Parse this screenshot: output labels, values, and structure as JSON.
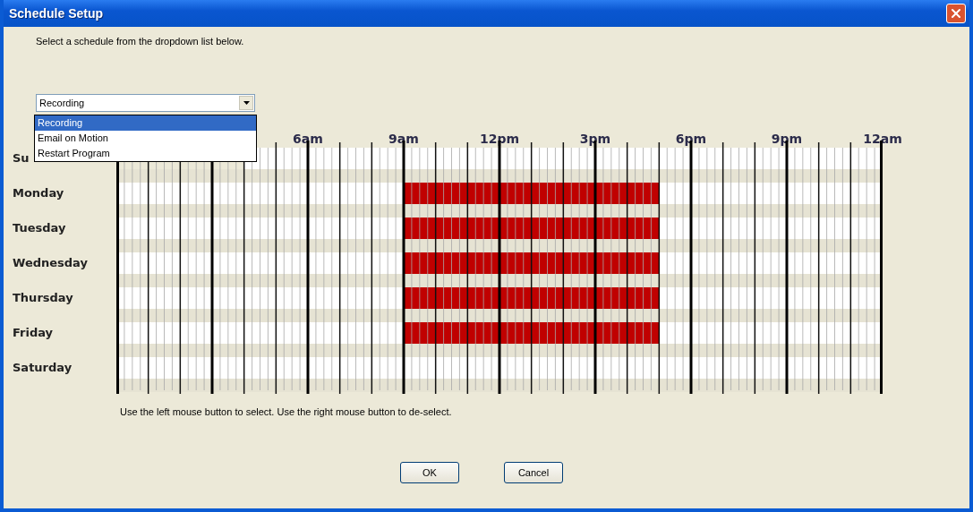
{
  "window": {
    "title": "Schedule Setup"
  },
  "instruction": "Select a schedule from the dropdown list below.",
  "schedule_select": {
    "value": "Recording",
    "options": [
      {
        "label": "Recording",
        "selected": true
      },
      {
        "label": "Email on Motion",
        "selected": false
      },
      {
        "label": "Restart Program",
        "selected": false
      }
    ]
  },
  "time_labels": [
    "6am",
    "9am",
    "12pm",
    "3pm",
    "6pm",
    "9pm",
    "12am"
  ],
  "days": [
    {
      "name": "Su",
      "hours": [
        {
          "selected": false
        },
        {
          "selected": false
        },
        {
          "selected": false
        },
        {
          "selected": false
        },
        {
          "selected": false
        },
        {
          "selected": false
        },
        {
          "selected": false
        },
        {
          "selected": false
        },
        {
          "selected": false
        },
        {
          "selected": false
        },
        {
          "selected": false
        },
        {
          "selected": false
        },
        {
          "selected": false
        },
        {
          "selected": false
        },
        {
          "selected": false
        },
        {
          "selected": false
        },
        {
          "selected": false
        },
        {
          "selected": false
        },
        {
          "selected": false
        },
        {
          "selected": false
        }
      ]
    },
    {
      "name": "Monday",
      "hours": [
        {
          "selected": false
        },
        {
          "selected": false
        },
        {
          "selected": false
        },
        {
          "selected": false
        },
        {
          "selected": false
        },
        {
          "selected": false
        },
        {
          "selected": false
        },
        {
          "selected": false
        },
        {
          "selected": false
        },
        {
          "selected": true
        },
        {
          "selected": true
        },
        {
          "selected": true
        },
        {
          "selected": true
        },
        {
          "selected": true
        },
        {
          "selected": true
        },
        {
          "selected": true
        },
        {
          "selected": true
        },
        {
          "selected": false
        },
        {
          "selected": false
        },
        {
          "selected": false
        },
        {
          "selected": false
        },
        {
          "selected": false
        },
        {
          "selected": false
        },
        {
          "selected": false
        }
      ]
    },
    {
      "name": "Tuesday",
      "hours": [
        {
          "selected": false
        },
        {
          "selected": false
        },
        {
          "selected": false
        },
        {
          "selected": false
        },
        {
          "selected": false
        },
        {
          "selected": false
        },
        {
          "selected": false
        },
        {
          "selected": false
        },
        {
          "selected": false
        },
        {
          "selected": true
        },
        {
          "selected": true
        },
        {
          "selected": true
        },
        {
          "selected": true
        },
        {
          "selected": true
        },
        {
          "selected": true
        },
        {
          "selected": true
        },
        {
          "selected": true
        },
        {
          "selected": false
        },
        {
          "selected": false
        },
        {
          "selected": false
        },
        {
          "selected": false
        },
        {
          "selected": false
        },
        {
          "selected": false
        },
        {
          "selected": false
        }
      ]
    },
    {
      "name": "Wednesday",
      "hours": [
        {
          "selected": false
        },
        {
          "selected": false
        },
        {
          "selected": false
        },
        {
          "selected": false
        },
        {
          "selected": false
        },
        {
          "selected": false
        },
        {
          "selected": false
        },
        {
          "selected": false
        },
        {
          "selected": false
        },
        {
          "selected": true
        },
        {
          "selected": true
        },
        {
          "selected": true
        },
        {
          "selected": true
        },
        {
          "selected": true
        },
        {
          "selected": true
        },
        {
          "selected": true
        },
        {
          "selected": true
        },
        {
          "selected": false
        },
        {
          "selected": false
        },
        {
          "selected": false
        },
        {
          "selected": false
        },
        {
          "selected": false
        },
        {
          "selected": false
        },
        {
          "selected": false
        }
      ]
    },
    {
      "name": "Thursday",
      "hours": [
        {
          "selected": false
        },
        {
          "selected": false
        },
        {
          "selected": false
        },
        {
          "selected": false
        },
        {
          "selected": false
        },
        {
          "selected": false
        },
        {
          "selected": false
        },
        {
          "selected": false
        },
        {
          "selected": false
        },
        {
          "selected": true
        },
        {
          "selected": true
        },
        {
          "selected": true
        },
        {
          "selected": true
        },
        {
          "selected": true
        },
        {
          "selected": true
        },
        {
          "selected": true
        },
        {
          "selected": true
        },
        {
          "selected": false
        },
        {
          "selected": false
        },
        {
          "selected": false
        },
        {
          "selected": false
        },
        {
          "selected": false
        },
        {
          "selected": false
        },
        {
          "selected": false
        }
      ]
    },
    {
      "name": "Friday",
      "hours": [
        {
          "selected": false
        },
        {
          "selected": false
        },
        {
          "selected": false
        },
        {
          "selected": false
        },
        {
          "selected": false
        },
        {
          "selected": false
        },
        {
          "selected": false
        },
        {
          "selected": false
        },
        {
          "selected": false
        },
        {
          "selected": true
        },
        {
          "selected": true
        },
        {
          "selected": true
        },
        {
          "selected": true
        },
        {
          "selected": true
        },
        {
          "selected": true
        },
        {
          "selected": true
        },
        {
          "selected": true
        },
        {
          "selected": false
        },
        {
          "selected": false
        },
        {
          "selected": false
        },
        {
          "selected": false
        },
        {
          "selected": false
        },
        {
          "selected": false
        },
        {
          "selected": false
        }
      ]
    },
    {
      "name": "Saturday",
      "hours": [
        {
          "selected": false
        },
        {
          "selected": false
        },
        {
          "selected": false
        },
        {
          "selected": false
        },
        {
          "selected": false
        },
        {
          "selected": false
        },
        {
          "selected": false
        },
        {
          "selected": false
        },
        {
          "selected": false
        },
        {
          "selected": false
        },
        {
          "selected": false
        },
        {
          "selected": false
        },
        {
          "selected": false
        },
        {
          "selected": false
        },
        {
          "selected": false
        },
        {
          "selected": false
        },
        {
          "selected": false
        },
        {
          "selected": false
        },
        {
          "selected": false
        },
        {
          "selected": false
        },
        {
          "selected": false
        },
        {
          "selected": false
        },
        {
          "selected": false
        },
        {
          "selected": false
        }
      ]
    }
  ],
  "hint": "Use the left mouse button to select. Use the right mouse button to de-select.",
  "buttons": [
    "OK",
    "Cancel"
  ]
}
